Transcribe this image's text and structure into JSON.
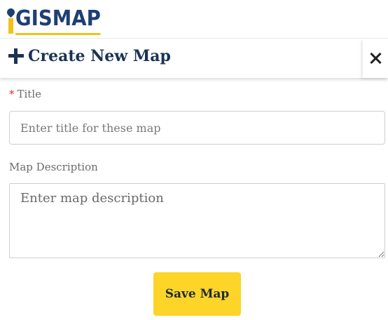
{
  "logo": {
    "text": "GISMAP",
    "icon": "map-pin-icon",
    "colors": {
      "primary": "#1f3f73",
      "accent": "#f2c21a"
    }
  },
  "modal": {
    "title": "Create New Map",
    "title_icon": "plus-icon",
    "close_icon": "close-icon"
  },
  "form": {
    "title_field": {
      "required_mark": "*",
      "label": "Title",
      "value": "",
      "placeholder": "Enter title for these map"
    },
    "description_field": {
      "label": "Map Description",
      "value": "",
      "placeholder": "Enter map description"
    },
    "save_label": "Save Map"
  },
  "colors": {
    "save_button": "#fdd428",
    "required": "#d9342b",
    "heading": "#1a3354"
  }
}
